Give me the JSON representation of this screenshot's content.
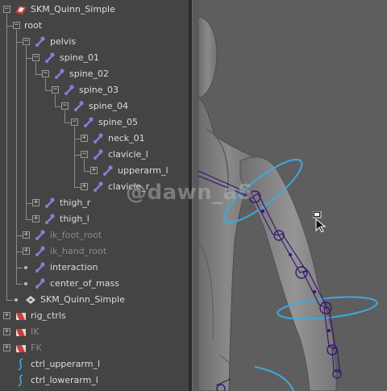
{
  "outliner": {
    "nodes": [
      {
        "label": "SKM_Quinn_Simple",
        "depth": 0,
        "icon": "skeletal-mesh-icon",
        "toggle": "minus",
        "dim": false
      },
      {
        "label": "root",
        "depth": 1,
        "icon": "",
        "toggle": "minus",
        "dim": false
      },
      {
        "label": "pelvis",
        "depth": 2,
        "icon": "joint-icon",
        "toggle": "minus",
        "dim": false
      },
      {
        "label": "spine_01",
        "depth": 3,
        "icon": "joint-icon",
        "toggle": "minus",
        "dim": false
      },
      {
        "label": "spine_02",
        "depth": 4,
        "icon": "joint-icon",
        "toggle": "minus",
        "dim": false
      },
      {
        "label": "spine_03",
        "depth": 5,
        "icon": "joint-icon",
        "toggle": "minus",
        "dim": false
      },
      {
        "label": "spine_04",
        "depth": 6,
        "icon": "joint-icon",
        "toggle": "minus",
        "dim": false
      },
      {
        "label": "spine_05",
        "depth": 7,
        "icon": "joint-icon",
        "toggle": "minus",
        "dim": false
      },
      {
        "label": "neck_01",
        "depth": 8,
        "icon": "joint-icon",
        "toggle": "plus",
        "dim": false
      },
      {
        "label": "clavicle_l",
        "depth": 8,
        "icon": "joint-icon",
        "toggle": "minus",
        "dim": false
      },
      {
        "label": "upperarm_l",
        "depth": 9,
        "icon": "joint-icon",
        "toggle": "plus",
        "dim": false
      },
      {
        "label": "clavicle_r",
        "depth": 8,
        "icon": "joint-icon",
        "toggle": "plus",
        "dim": false
      },
      {
        "label": "thigh_r",
        "depth": 3,
        "icon": "joint-icon",
        "toggle": "plus",
        "dim": false
      },
      {
        "label": "thigh_l",
        "depth": 3,
        "icon": "joint-icon",
        "toggle": "plus",
        "dim": false
      },
      {
        "label": "ik_foot_root",
        "depth": 2,
        "icon": "joint-icon",
        "toggle": "plus",
        "dim": true
      },
      {
        "label": "ik_hand_root",
        "depth": 2,
        "icon": "joint-icon",
        "toggle": "plus",
        "dim": true
      },
      {
        "label": "interaction",
        "depth": 2,
        "icon": "joint-icon",
        "toggle": "dot",
        "dim": false
      },
      {
        "label": "center_of_mass",
        "depth": 2,
        "icon": "joint-icon",
        "toggle": "dot",
        "dim": false
      },
      {
        "label": "SKM_Quinn_Simple",
        "depth": 1,
        "icon": "mesh-icon",
        "toggle": "dot",
        "dim": false
      },
      {
        "label": "rig_ctrls",
        "depth": 0,
        "icon": "group-icon",
        "toggle": "plus",
        "dim": false
      },
      {
        "label": "IK",
        "depth": 0,
        "icon": "group-icon",
        "toggle": "plus",
        "dim": true
      },
      {
        "label": "FK",
        "depth": 0,
        "icon": "group-icon",
        "toggle": "plus",
        "dim": true
      },
      {
        "label": "ctrl_upperarm_l",
        "depth": 0,
        "icon": "curve-icon",
        "toggle": "none",
        "dim": false
      },
      {
        "label": "ctrl_lowerarm_l",
        "depth": 0,
        "icon": "curve-icon",
        "toggle": "none",
        "dim": false
      },
      {
        "label": "",
        "depth": 0,
        "icon": "curve-icon",
        "toggle": "none",
        "dim": false
      }
    ]
  },
  "watermark": "@dawn_aS",
  "colors": {
    "joint": "#8d7bd8",
    "ctrl_curve": "#3fa8e0",
    "skeleton": "#3a1870",
    "mesh_icon_red": "#d13a3a"
  }
}
